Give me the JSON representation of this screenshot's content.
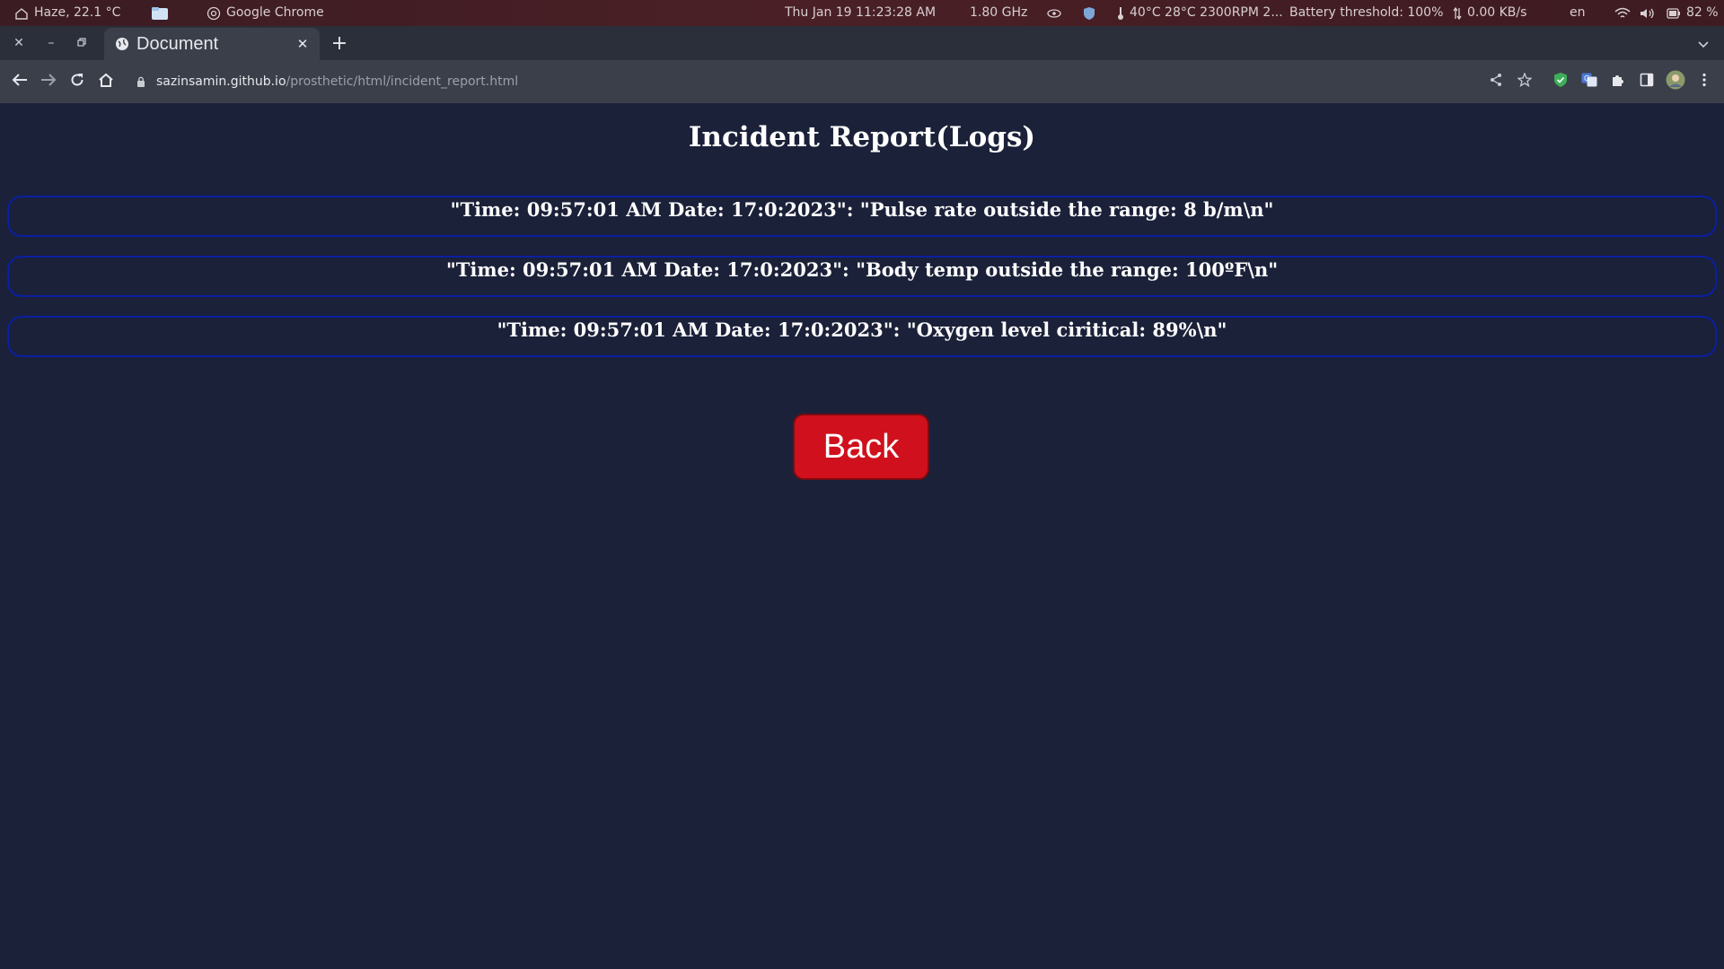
{
  "system_bar": {
    "weather": "Haze, 22.1 °C",
    "active_app": "Google Chrome",
    "datetime": "Thu Jan 19  11:23:28 AM",
    "cpu_freq": "1.80 GHz",
    "sensors": "40°C 28°C 2300RPM 2...",
    "battery_threshold": "Battery threshold: 100%",
    "network_speed": "0.00 KB/s",
    "language": "en",
    "battery": "82 %"
  },
  "browser": {
    "tab_title": "Document",
    "url_host": "sazinsamin.github.io",
    "url_path": "/prosthetic/html/incident_report.html"
  },
  "page": {
    "title": "Incident Report(Logs)",
    "logs": [
      "\"Time: 09:57:01 AM Date: 17:0:2023\": \"Pulse rate outside the range: 8 b/m\\n\"",
      "\"Time: 09:57:01 AM Date: 17:0:2023\": \"Body temp outside the range: 100ºF\\n\"",
      "\"Time: 09:57:01 AM Date: 17:0:2023\": \"Oxygen level ciritical: 89%\\n\""
    ],
    "back_label": "Back"
  },
  "colors": {
    "page_background": "#1b2139",
    "log_border": "#0a1fa3",
    "back_button": "#d0101c"
  },
  "icons": {
    "system_bar": [
      "home-weather-icon",
      "files-icon",
      "chrome-icon",
      "eye-icon",
      "shield-icon",
      "thermometer-icon",
      "updown-arrows-icon",
      "wifi-icon",
      "volume-icon",
      "battery-icon"
    ],
    "toolbar": [
      "back-arrow-icon",
      "forward-arrow-icon",
      "reload-icon",
      "home-icon",
      "lock-icon",
      "share-icon",
      "star-icon",
      "adblock-shield-icon",
      "translate-icon",
      "extensions-puzzle-icon",
      "side-panel-icon",
      "profile-avatar-icon",
      "kebab-menu-icon"
    ]
  }
}
